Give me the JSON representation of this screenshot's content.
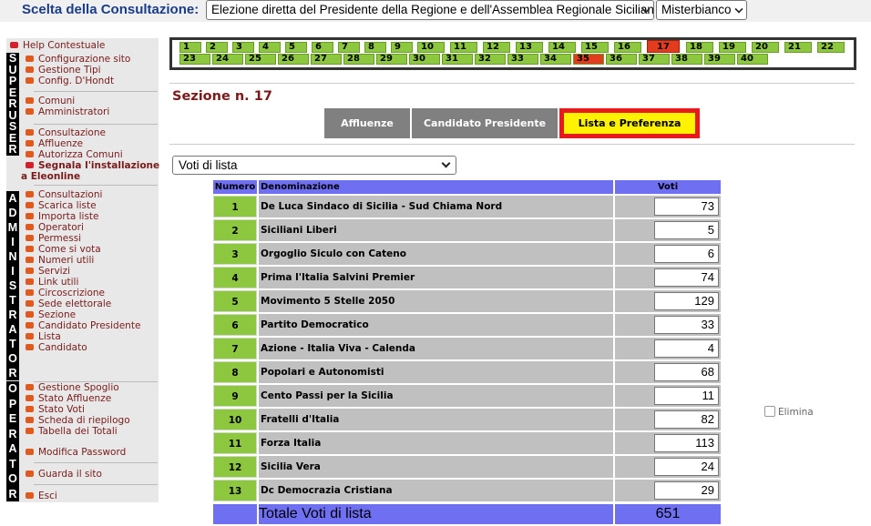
{
  "topbar": {
    "title": "Scelta della Consultazione:",
    "consultazione": "Elezione diretta del Presidente della Regione e dell'Assemblea Regionale Siciliana",
    "comune": "Misterbianco"
  },
  "sidebar": {
    "help": "Help Contestuale",
    "strip1": [
      "S",
      "U",
      "P",
      "E",
      "R",
      "U",
      "S",
      "E",
      "R"
    ],
    "strip2": [
      "A",
      "D",
      "M",
      "I",
      "N",
      "I",
      "S",
      "T",
      "R",
      "A",
      "T",
      "O",
      "R"
    ],
    "strip3": [
      "O",
      "P",
      "E",
      "R",
      "A",
      "T",
      "O",
      "R"
    ],
    "group1": [
      "Configurazione sito",
      "Gestione Tipi",
      "Config. D'Hondt"
    ],
    "group2": [
      "Comuni",
      "Amministratori"
    ],
    "group3": [
      "Consultazione",
      "Affluenze",
      "Autorizza Comuni",
      "Segnala l'installazione"
    ],
    "group3_tail": "a Eleonline",
    "group4": [
      "Consultazioni",
      "Scarica liste",
      "Importa liste",
      "Operatori",
      "Permessi",
      "Come si vota",
      "Numeri utili",
      "Servizi",
      "Link utili",
      "Circoscrizione",
      "Sede elettorale",
      "Sezione",
      "Candidato Presidente",
      "Lista",
      "Candidato"
    ],
    "group5": [
      "Gestione Spoglio",
      "Stato Affluenze",
      "Stato Voti",
      "Scheda di riepilogo",
      "Tabella dei Totali"
    ],
    "modifica": "Modifica Password",
    "guarda": "Guarda il sito",
    "esci": "Esci"
  },
  "sections": {
    "row1": [
      "1",
      "2",
      "3",
      "4",
      "5",
      "6",
      "7",
      "8",
      "9",
      "10",
      "11",
      "12",
      "13",
      "14",
      "15",
      "16",
      "17",
      "18",
      "19",
      "20",
      "21",
      "22"
    ],
    "row2": [
      "23",
      "24",
      "25",
      "26",
      "27",
      "28",
      "29",
      "30",
      "31",
      "32",
      "33",
      "34",
      "35",
      "36",
      "37",
      "38",
      "39",
      "40"
    ],
    "current": "17",
    "highlight_color": "#e23b1e",
    "cell_color": "#8dc63f"
  },
  "sezione_title": "Sezione n. 17",
  "tabs": {
    "affluenze": "Affluenze",
    "candidato": "Candidato Presidente",
    "lista": "Lista e Preferenza"
  },
  "dropdown": "Voti di lista",
  "table": {
    "headers": {
      "numero": "Numero",
      "denominazione": "Denominazione",
      "voti": "Voti"
    },
    "rows": [
      {
        "num": "1",
        "name": "De Luca Sindaco di Sicilia - Sud Chiama Nord",
        "voti": "73"
      },
      {
        "num": "2",
        "name": "Siciliani Liberi",
        "voti": "5"
      },
      {
        "num": "3",
        "name": "Orgoglio Siculo con Cateno",
        "voti": "6"
      },
      {
        "num": "4",
        "name": "Prima l'Italia Salvini Premier",
        "voti": "74"
      },
      {
        "num": "5",
        "name": "Movimento 5 Stelle 2050",
        "voti": "129"
      },
      {
        "num": "6",
        "name": "Partito Democratico",
        "voti": "33"
      },
      {
        "num": "7",
        "name": "Azione - Italia Viva - Calenda",
        "voti": "4"
      },
      {
        "num": "8",
        "name": "Popolari e Autonomisti",
        "voti": "68"
      },
      {
        "num": "9",
        "name": "Cento Passi per la Sicilia",
        "voti": "11"
      },
      {
        "num": "10",
        "name": "Fratelli d'Italia",
        "voti": "82"
      },
      {
        "num": "11",
        "name": "Forza Italia",
        "voti": "113"
      },
      {
        "num": "12",
        "name": "Sicilia Vera",
        "voti": "24"
      },
      {
        "num": "13",
        "name": "Dc Democrazia Cristiana",
        "voti": "29"
      }
    ],
    "totale_label": "Totale Voti di lista",
    "totale_value": "651"
  },
  "elimina": "Elimina"
}
